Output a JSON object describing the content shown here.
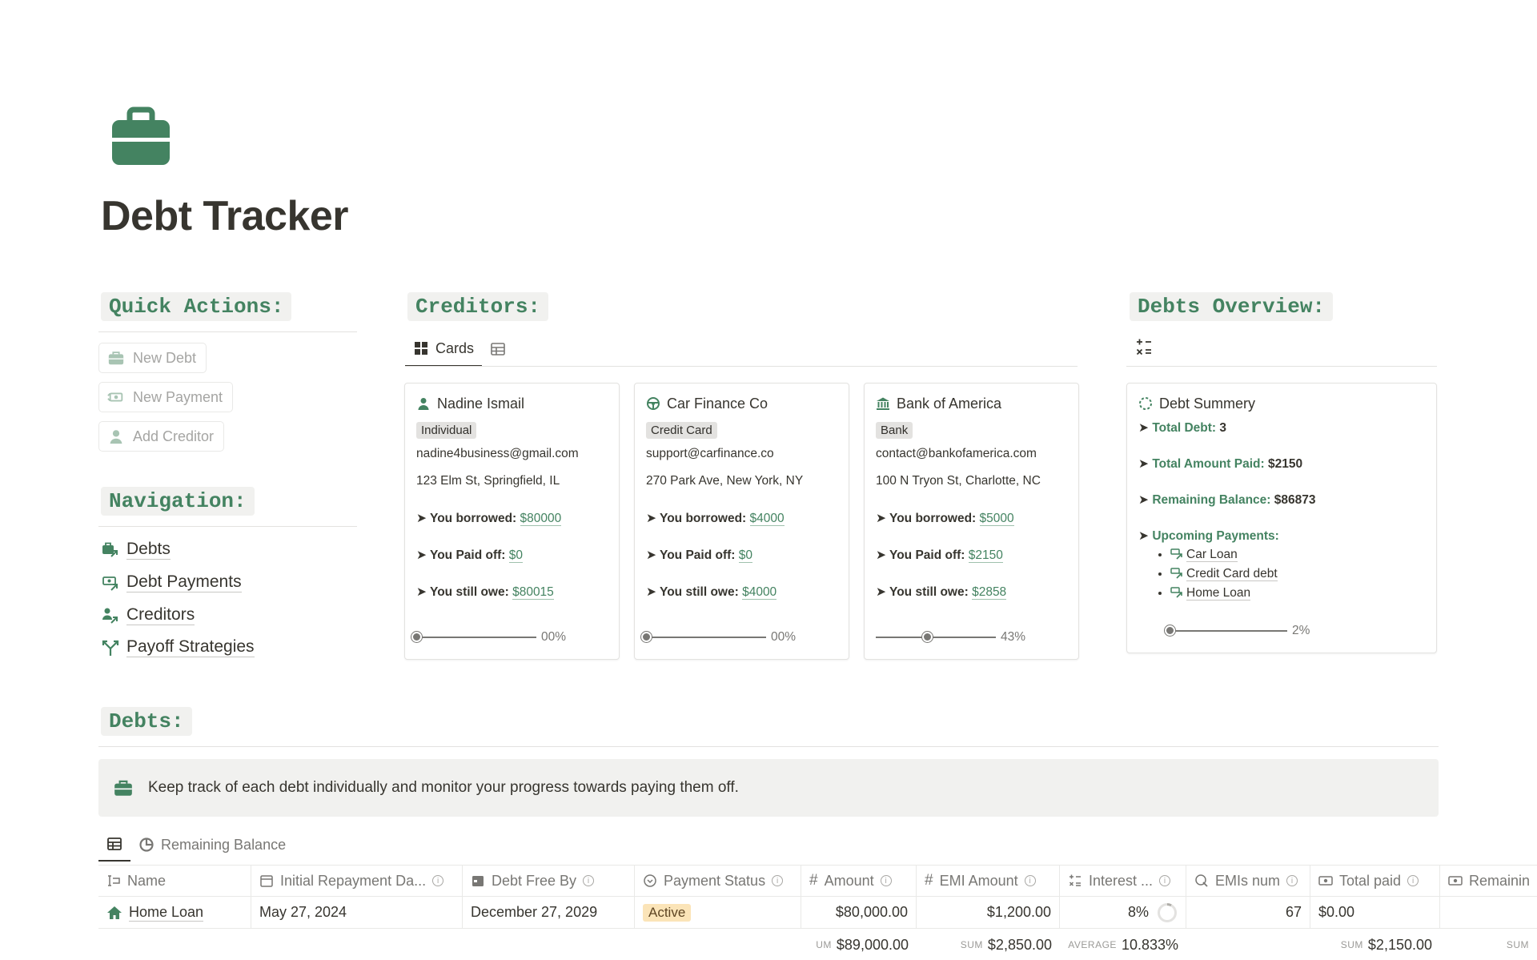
{
  "page": {
    "title": "Debt Tracker",
    "icon": "briefcase-icon",
    "accent": "#448361"
  },
  "quick_actions": {
    "heading": "Quick Actions:",
    "buttons": [
      {
        "label": "New Debt",
        "icon": "briefcase-icon"
      },
      {
        "label": "New Payment",
        "icon": "money-transfer-icon"
      },
      {
        "label": "Add Creditor",
        "icon": "person-icon"
      }
    ]
  },
  "navigation": {
    "heading": "Navigation:",
    "items": [
      {
        "label": "Debts",
        "icon": "briefcase-link-icon"
      },
      {
        "label": "Debt Payments",
        "icon": "money-link-icon"
      },
      {
        "label": "Creditors",
        "icon": "person-link-icon"
      },
      {
        "label": "Payoff Strategies",
        "icon": "split-arrows-icon"
      }
    ]
  },
  "creditors": {
    "heading": "Creditors:",
    "tabs": [
      {
        "label": "Cards",
        "icon": "grid-icon"
      },
      {
        "label": "",
        "icon": "table-icon"
      }
    ],
    "cards": [
      {
        "name": "Nadine Ismail",
        "icon": "person-icon",
        "type": "Individual",
        "email": "nadine4business@gmail.com",
        "address": "123 Elm St, Springfield, IL",
        "borrowed_label": "➤ You borrowed:",
        "borrowed": "$80000",
        "paid_label": "➤ You Paid off:",
        "paid": "$0",
        "owe_label": "➤ You still owe:",
        "owe": "$80015",
        "progress_text": "00%",
        "progress": 0
      },
      {
        "name": "Car Finance Co",
        "icon": "steering-wheel-icon",
        "type": "Credit Card",
        "email": "support@carfinance.co",
        "address": "270 Park Ave, New York, NY",
        "borrowed_label": "➤ You borrowed:",
        "borrowed": "$4000",
        "paid_label": "➤ You Paid off:",
        "paid": "$0",
        "owe_label": "➤ You still owe:",
        "owe": "$4000",
        "progress_text": "00%",
        "progress": 0
      },
      {
        "name": "Bank of America",
        "icon": "bank-icon",
        "type": "Bank",
        "email": "contact@bankofamerica.com",
        "address": "100 N Tryon St, Charlotte, NC",
        "borrowed_label": "➤ You borrowed:",
        "borrowed": "$5000",
        "paid_label": "➤ You Paid off:",
        "paid": "$2150",
        "owe_label": "➤ You still owe:",
        "owe": "$2858",
        "progress_text": "43%",
        "progress": 0.43
      }
    ]
  },
  "overview": {
    "heading": "Debts Overview:",
    "toolbar_icon": "calculator-ops-icon",
    "summary": {
      "title": "Debt Summery",
      "total_debt_label": "Total Debt:",
      "total_debt": "3",
      "total_paid_label": "Total Amount Paid:",
      "total_paid": "$2150",
      "remaining_label": "Remaining Balance:",
      "remaining": "$86873",
      "upcoming_label": "Upcoming Payments:",
      "upcoming": [
        "Car Loan",
        "Credit Card debt",
        "Home Loan"
      ],
      "progress_text": "2%",
      "progress": 0.02,
      "arrow": "➤"
    }
  },
  "debts": {
    "heading": "Debts:",
    "callout": "Keep track of each debt individually and monitor your progress towards paying them off.",
    "views": [
      {
        "label": "",
        "icon": "table-icon"
      },
      {
        "label": "Remaining Balance",
        "icon": "pie-chart-icon"
      }
    ],
    "columns": [
      "Name",
      "Initial Repayment Da...",
      "Debt Free By",
      "Payment Status",
      "Amount",
      "EMI Amount",
      "Interest ...",
      "EMIs num",
      "Total paid",
      "Remainin"
    ],
    "rows": [
      {
        "name": "Home Loan",
        "initial": "May 27, 2024",
        "free_by": "December 27, 2029",
        "status": "Active",
        "amount": "$80,000.00",
        "emi": "$1,200.00",
        "interest": "8%",
        "emis": "67",
        "paid": "$0.00",
        "remaining": ""
      }
    ],
    "footer": {
      "amount_agg": "UM",
      "amount": "$89,000.00",
      "emi_agg": "SUM",
      "emi": "$2,850.00",
      "interest_agg": "AVERAGE",
      "interest": "10.833%",
      "paid_agg": "SUM",
      "paid": "$2,150.00",
      "remaining_agg": "SUM"
    }
  }
}
